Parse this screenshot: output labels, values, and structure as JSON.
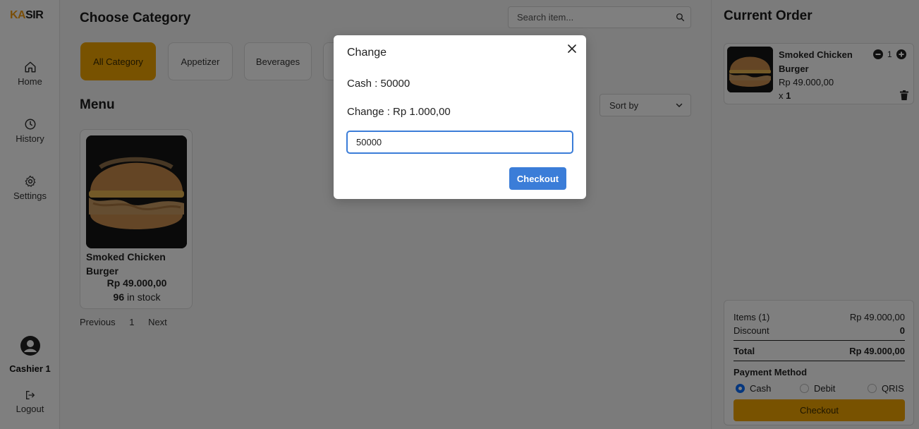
{
  "nav": {
    "logo_ka": "KA",
    "logo_sir": "SIR",
    "items": [
      {
        "label": "Home",
        "icon": "home-icon"
      },
      {
        "label": "History",
        "icon": "history-icon"
      },
      {
        "label": "Settings",
        "icon": "gear-icon"
      }
    ],
    "user": "Cashier 1",
    "logout": "Logout"
  },
  "main": {
    "title": "Choose Category",
    "search_placeholder": "Search item...",
    "categories": [
      "All Category",
      "Appetizer",
      "Beverages"
    ],
    "menu_title": "Menu",
    "sort_label": "Sort by",
    "product": {
      "name": "Smoked Chicken Burger",
      "price": "Rp 49.000,00",
      "stock_count": "96",
      "stock_suffix": " in stock"
    },
    "pager": {
      "prev": "Previous",
      "page": "1",
      "next": "Next"
    }
  },
  "order": {
    "title": "Current Order",
    "item": {
      "name": "Smoked Chicken Burger",
      "price": "Rp 49.000,00",
      "qty_prefix": "x ",
      "qty": "1",
      "stepper_value": "1"
    },
    "summary": {
      "items_label": "Items (1)",
      "items_value": "Rp 49.000,00",
      "discount_label": "Discount",
      "discount_value": "0",
      "total_label": "Total",
      "total_value": "Rp 49.000,00",
      "payment_title": "Payment Method",
      "methods": [
        "Cash",
        "Debit",
        "QRIS"
      ],
      "selected_method": "Cash",
      "checkout": "Checkout"
    }
  },
  "modal": {
    "title": "Change",
    "cash_line": "Cash : 50000",
    "change_line": "Change : Rp 1.000,00",
    "input_value": "50000",
    "button": "Checkout"
  },
  "colors": {
    "accent": "#f0a500",
    "primary": "#3b7dd8",
    "logo_accent": "#f39c12"
  }
}
